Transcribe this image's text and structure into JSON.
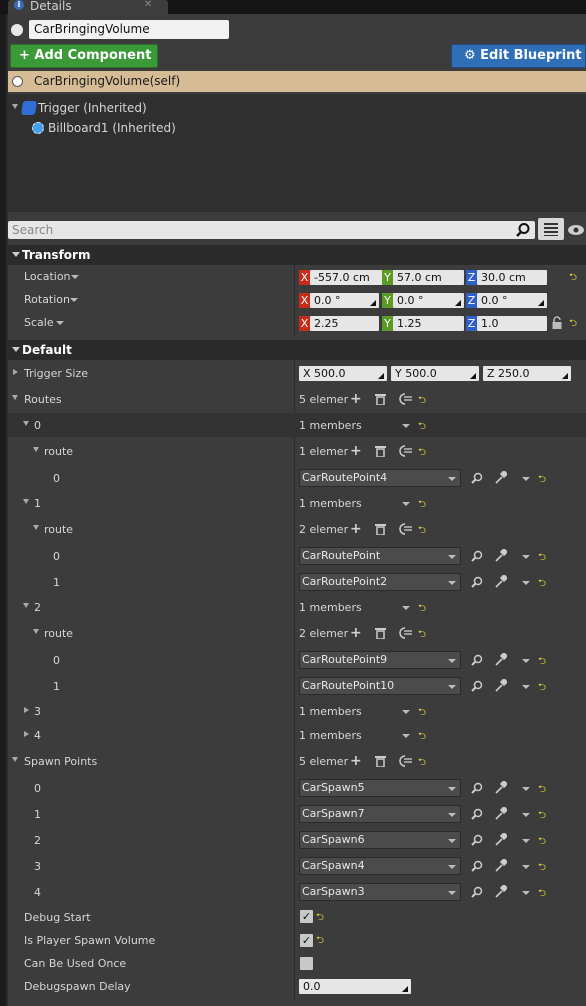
{
  "tab": {
    "icon_glyph": "i",
    "label": "Details",
    "close_glyph": "✕"
  },
  "actor": {
    "name": "CarBringingVolume"
  },
  "toolbar": {
    "add_component": "+ Add Component ▾",
    "edit_blueprint": "⚙ Edit Blueprint ▾"
  },
  "components": {
    "self": "CarBringingVolume(self)",
    "children": [
      {
        "label": "Trigger (Inherited)",
        "icon": "trigger-shape-icon"
      },
      {
        "label": "Billboard1 (Inherited)",
        "icon": "billboard-icon"
      }
    ]
  },
  "search": {
    "placeholder": "Search"
  },
  "transform": {
    "title": "Transform",
    "location": {
      "label": "Location",
      "x": "-557.0 cm",
      "y": "57.0 cm",
      "z": "30.0 cm"
    },
    "rotation": {
      "label": "Rotation",
      "x": "0.0 °",
      "y": "0.0 °",
      "z": "0.0 °"
    },
    "scale": {
      "label": "Scale",
      "x": "2.25",
      "y": "1.25",
      "z": "1.0"
    }
  },
  "axis": {
    "x": "X",
    "y": "Y",
    "z": "Z"
  },
  "reset_glyph": "⮌",
  "default": {
    "title": "Default",
    "trigger_size": {
      "label": "Trigger Size",
      "x": "X  500.0",
      "y": "Y  500.0",
      "z": "Z  250.0"
    },
    "routes": {
      "label": "Routes",
      "count": "5 elemer",
      "items": [
        {
          "index": "0",
          "members": "1 members",
          "route_label": "route",
          "route_count": "1 elemer",
          "points": [
            {
              "index": "0",
              "value": "CarRoutePoint4"
            }
          ]
        },
        {
          "index": "1",
          "members": "1 members",
          "route_label": "route",
          "route_count": "2 elemer",
          "points": [
            {
              "index": "0",
              "value": "CarRoutePoint"
            },
            {
              "index": "1",
              "value": "CarRoutePoint2"
            }
          ]
        },
        {
          "index": "2",
          "members": "1 members",
          "route_label": "route",
          "route_count": "2 elemer",
          "points": [
            {
              "index": "0",
              "value": "CarRoutePoint9"
            },
            {
              "index": "1",
              "value": "CarRoutePoint10"
            }
          ]
        },
        {
          "index": "3",
          "members": "1 members"
        },
        {
          "index": "4",
          "members": "1 members"
        }
      ]
    },
    "spawn_points": {
      "label": "Spawn Points",
      "count": "5 elemer",
      "items": [
        {
          "index": "0",
          "value": "CarSpawn5"
        },
        {
          "index": "1",
          "value": "CarSpawn7"
        },
        {
          "index": "2",
          "value": "CarSpawn6"
        },
        {
          "index": "3",
          "value": "CarSpawn4"
        },
        {
          "index": "4",
          "value": "CarSpawn3"
        }
      ]
    },
    "debug_start": {
      "label": "Debug Start",
      "checked": true
    },
    "is_player_spawn_volume": {
      "label": "Is Player Spawn Volume",
      "checked": true
    },
    "can_be_used_once": {
      "label": "Can Be Used Once",
      "checked": false
    },
    "debugspawn_delay": {
      "label": "Debugspawn Delay",
      "value": "0.0"
    }
  },
  "colors": {
    "add_component": "#3a9a38",
    "edit_blueprint": "#2e6fb8",
    "selected_row": "#d6bc95",
    "axis_x": "#c52c19",
    "axis_y": "#5a9a25",
    "axis_z": "#2f5fc7",
    "reset_arrow": "#e9d93a"
  }
}
